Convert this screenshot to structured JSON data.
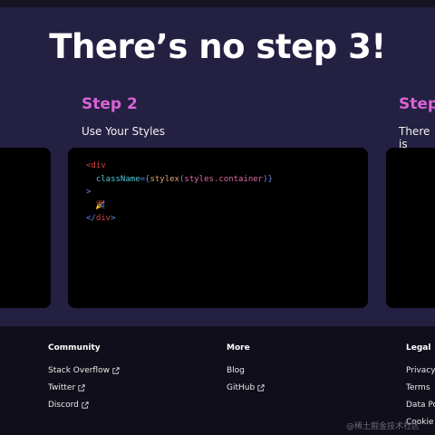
{
  "hero": {
    "title": "There’s no step 3!"
  },
  "steps": [
    {
      "title": "Step 2",
      "description": "Use Your Styles"
    },
    {
      "title": "Step",
      "description": "There is"
    }
  ],
  "code": {
    "open_tag_start": "<",
    "open_tag_name": "div",
    "attr_name": "className",
    "attr_eq": "=",
    "brace_open": "{",
    "fn_name": "stylex",
    "paren_open": "(",
    "arg": "styles.container",
    "paren_close": ")",
    "brace_close": "}",
    "open_tag_end": ">",
    "emoji": "🎉",
    "close_tag_start": "</",
    "close_tag_name": "div",
    "close_tag_end": ">"
  },
  "footer": {
    "columns": [
      {
        "heading": "Community",
        "links": [
          "Stack Overflow",
          "Twitter",
          "Discord"
        ]
      },
      {
        "heading": "More",
        "links": [
          "Blog",
          "GitHub"
        ]
      },
      {
        "heading": "Legal",
        "links": [
          "Privacy",
          "Terms",
          "Data Po",
          "Cookie"
        ]
      }
    ],
    "external_icon": "external-link-icon"
  },
  "watermark": "@稀土掘金技术社区",
  "colors": {
    "background": "#232042",
    "footer": "#100e1a",
    "accent": "#d963d4",
    "code_panel": "#000000"
  }
}
